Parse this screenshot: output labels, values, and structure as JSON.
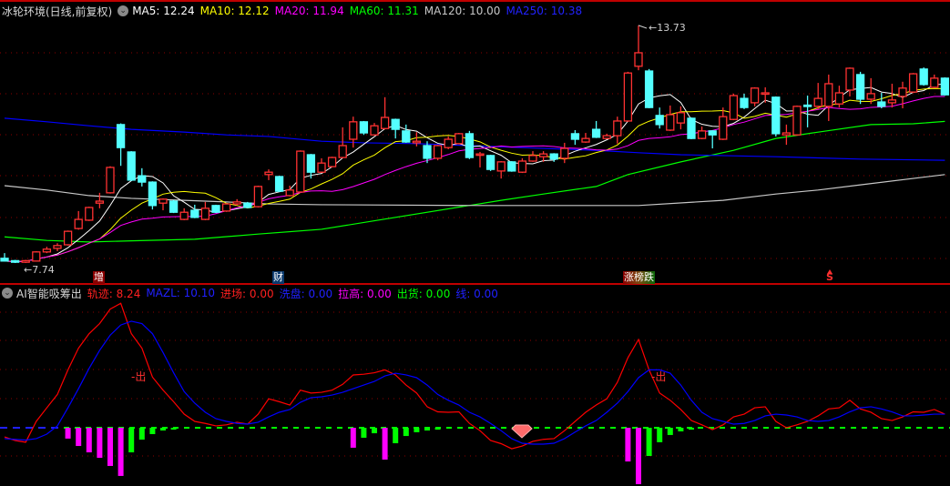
{
  "main_header": {
    "title": "冰轮环境(日线,前复权)",
    "ma_labels": [
      {
        "text": "MA5: 12.24",
        "color": "#ffffff"
      },
      {
        "text": "MA10: 12.12",
        "color": "#ffff00"
      },
      {
        "text": "MA20: 11.94",
        "color": "#ff00ff"
      },
      {
        "text": "MA60: 11.31",
        "color": "#00ff00"
      },
      {
        "text": "MA120: 10.00",
        "color": "#c8c8c8"
      },
      {
        "text": "MA250: 10.38",
        "color": "#0000ff"
      }
    ]
  },
  "indicator_header": {
    "title": "AI智能吸筹出",
    "items": [
      {
        "text": "轨迹: 8.24",
        "color": "#ff2020"
      },
      {
        "text": "MAZL: 10.10",
        "color": "#2020ff"
      },
      {
        "text": "进场: 0.00",
        "color": "#ff2020"
      },
      {
        "text": "洗盘: 0.00",
        "color": "#2020ff"
      },
      {
        "text": "拉高: 0.00",
        "color": "#ff00ff"
      },
      {
        "text": "出货: 0.00",
        "color": "#00ff00"
      },
      {
        "text": "线: 0.00",
        "color": "#2020ff"
      }
    ]
  },
  "annotations": {
    "high_label": "13.73",
    "low_label": "7.74",
    "event_tags": [
      {
        "text": "增",
        "bg": "#8b0000"
      },
      {
        "text": "财",
        "bg": "#0a3a6e"
      },
      {
        "text": "涨榜跌",
        "bg": "#7a2a10"
      }
    ],
    "signal_s": "S",
    "exit_labels": [
      "-出",
      "-出"
    ]
  },
  "colors": {
    "up": "#ff3232",
    "down": "#54ffff",
    "grid": "#8b0000"
  },
  "chart_data": [
    {
      "type": "candlestick",
      "title": "冰轮环境(日线,前复权)",
      "ylim": [
        7.74,
        13.73
      ],
      "ohlc": [
        [
          7.86,
          7.99,
          7.78,
          7.79
        ],
        [
          7.8,
          7.82,
          7.74,
          7.76
        ],
        [
          7.76,
          7.82,
          7.74,
          7.8
        ],
        [
          7.79,
          8.04,
          7.78,
          8.02
        ],
        [
          8.02,
          8.15,
          7.99,
          8.09
        ],
        [
          8.11,
          8.24,
          8.04,
          8.18
        ],
        [
          8.2,
          8.56,
          8.18,
          8.54
        ],
        [
          8.61,
          9.05,
          8.58,
          8.84
        ],
        [
          8.82,
          9.16,
          8.8,
          9.14
        ],
        [
          9.25,
          9.51,
          9.12,
          9.3
        ],
        [
          9.51,
          10.18,
          9.49,
          10.15
        ],
        [
          11.23,
          11.26,
          10.19,
          10.65
        ],
        [
          10.54,
          10.56,
          9.81,
          9.83
        ],
        [
          9.94,
          10.13,
          9.67,
          9.78
        ],
        [
          9.78,
          9.8,
          9.09,
          9.19
        ],
        [
          9.25,
          9.37,
          9.07,
          9.35
        ],
        [
          9.3,
          9.33,
          9.0,
          9.02
        ],
        [
          8.84,
          9.12,
          8.82,
          9.02
        ],
        [
          9.07,
          9.21,
          8.87,
          8.89
        ],
        [
          8.84,
          9.28,
          8.82,
          9.12
        ],
        [
          9.19,
          9.21,
          9.0,
          9.02
        ],
        [
          9.05,
          9.25,
          9.03,
          9.23
        ],
        [
          9.23,
          9.35,
          9.19,
          9.28
        ],
        [
          9.25,
          9.28,
          9.12,
          9.14
        ],
        [
          9.16,
          9.69,
          9.14,
          9.67
        ],
        [
          9.97,
          10.1,
          9.83,
          10.03
        ],
        [
          9.92,
          9.94,
          9.53,
          9.55
        ],
        [
          9.44,
          9.69,
          9.42,
          9.58
        ],
        [
          9.53,
          10.58,
          9.51,
          10.56
        ],
        [
          10.47,
          10.49,
          9.87,
          10.03
        ],
        [
          10.03,
          10.38,
          10.01,
          10.26
        ],
        [
          10.17,
          10.42,
          10.15,
          10.4
        ],
        [
          10.4,
          11.16,
          10.38,
          10.7
        ],
        [
          10.86,
          11.43,
          10.65,
          11.3
        ],
        [
          11.3,
          11.32,
          10.97,
          11.02
        ],
        [
          10.97,
          11.27,
          10.95,
          11.2
        ],
        [
          11.13,
          11.92,
          11.11,
          11.41
        ],
        [
          11.36,
          11.38,
          10.88,
          11.11
        ],
        [
          11.07,
          11.23,
          10.77,
          10.79
        ],
        [
          10.77,
          11.04,
          10.68,
          10.81
        ],
        [
          10.7,
          10.81,
          10.26,
          10.38
        ],
        [
          10.38,
          10.72,
          10.33,
          10.7
        ],
        [
          10.65,
          10.93,
          10.61,
          10.86
        ],
        [
          10.75,
          11.02,
          10.73,
          11.0
        ],
        [
          11.0,
          11.07,
          10.36,
          10.4
        ],
        [
          10.49,
          10.54,
          10.15,
          10.49
        ],
        [
          10.45,
          10.47,
          10.06,
          10.1
        ],
        [
          10.06,
          10.31,
          9.87,
          10.29
        ],
        [
          10.29,
          10.31,
          10.04,
          10.06
        ],
        [
          10.03,
          10.38,
          10.01,
          10.31
        ],
        [
          10.31,
          10.56,
          10.29,
          10.45
        ],
        [
          10.42,
          10.56,
          10.29,
          10.49
        ],
        [
          10.49,
          10.51,
          10.29,
          10.36
        ],
        [
          10.38,
          10.77,
          10.26,
          10.63
        ],
        [
          11.0,
          11.09,
          10.72,
          10.86
        ],
        [
          10.79,
          11.02,
          10.77,
          10.88
        ],
        [
          11.11,
          11.32,
          10.89,
          10.91
        ],
        [
          10.88,
          11.0,
          10.86,
          10.95
        ],
        [
          10.95,
          11.43,
          10.75,
          11.32
        ],
        [
          11.32,
          12.56,
          11.3,
          12.53
        ],
        [
          12.7,
          13.73,
          12.6,
          13.04
        ],
        [
          12.58,
          12.63,
          11.64,
          11.66
        ],
        [
          11.46,
          11.66,
          11.13,
          11.23
        ],
        [
          11.09,
          11.71,
          11.07,
          11.48
        ],
        [
          11.27,
          11.69,
          11.11,
          11.53
        ],
        [
          11.39,
          11.41,
          10.86,
          10.88
        ],
        [
          10.88,
          11.18,
          10.86,
          11.07
        ],
        [
          11.07,
          11.09,
          10.63,
          10.97
        ],
        [
          10.86,
          11.66,
          10.84,
          11.43
        ],
        [
          11.36,
          12.01,
          11.34,
          11.96
        ],
        [
          11.89,
          12.01,
          11.62,
          11.66
        ],
        [
          11.78,
          12.17,
          11.69,
          12.15
        ],
        [
          12.03,
          12.17,
          11.78,
          12.03
        ],
        [
          11.92,
          11.94,
          10.93,
          11.0
        ],
        [
          10.97,
          11.23,
          10.72,
          11.02
        ],
        [
          10.97,
          11.71,
          10.95,
          11.69
        ],
        [
          11.72,
          11.96,
          11.16,
          11.71
        ],
        [
          11.69,
          12.28,
          11.62,
          11.89
        ],
        [
          11.69,
          12.49,
          11.32,
          12.26
        ],
        [
          11.75,
          12.21,
          11.66,
          12.03
        ],
        [
          12.1,
          12.67,
          11.94,
          12.65
        ],
        [
          12.49,
          12.56,
          11.75,
          11.87
        ],
        [
          11.87,
          12.4,
          11.75,
          12.01
        ],
        [
          11.8,
          12.03,
          11.64,
          11.69
        ],
        [
          11.78,
          12.26,
          11.66,
          11.85
        ],
        [
          11.94,
          12.31,
          11.64,
          12.15
        ],
        [
          12.05,
          12.53,
          12.03,
          12.51
        ],
        [
          12.63,
          12.67,
          12.21,
          12.24
        ],
        [
          12.17,
          12.49,
          12.15,
          12.4
        ],
        [
          12.4,
          12.42,
          11.96,
          11.98
        ]
      ],
      "computed_ma": [
        {
          "name": "MA5",
          "period": 5,
          "color": "#ffffff"
        },
        {
          "name": "MA10",
          "period": 10,
          "color": "#ffff00"
        },
        {
          "name": "MA20",
          "period": 20,
          "color": "#ff00ff"
        }
      ],
      "sampled_ma": [
        {
          "name": "MA60",
          "color": "#00ff00",
          "points": [
            [
              0,
              8.4
            ],
            [
              4,
              8.31
            ],
            [
              8,
              8.27
            ],
            [
              12,
              8.3
            ],
            [
              18,
              8.34
            ],
            [
              24,
              8.47
            ],
            [
              30,
              8.59
            ],
            [
              47,
              9.32
            ],
            [
              51,
              9.48
            ],
            [
              56,
              9.67
            ],
            [
              59,
              9.97
            ],
            [
              64,
              10.29
            ],
            [
              69,
              10.58
            ],
            [
              73,
              10.88
            ],
            [
              77,
              11.04
            ],
            [
              82,
              11.23
            ],
            [
              86,
              11.25
            ],
            [
              89,
              11.31
            ]
          ]
        },
        {
          "name": "MA120",
          "color": "#c8c8c8",
          "points": [
            [
              0,
              9.69
            ],
            [
              4,
              9.58
            ],
            [
              8,
              9.44
            ],
            [
              12,
              9.37
            ],
            [
              17,
              9.32
            ],
            [
              21,
              9.28
            ],
            [
              25,
              9.23
            ],
            [
              30,
              9.21
            ],
            [
              45,
              9.19
            ],
            [
              60,
              9.19
            ],
            [
              68,
              9.32
            ],
            [
              73,
              9.48
            ],
            [
              77,
              9.58
            ],
            [
              81,
              9.71
            ],
            [
              89,
              9.97
            ]
          ]
        },
        {
          "name": "MA250",
          "color": "#0000ff",
          "points": [
            [
              0,
              11.39
            ],
            [
              4,
              11.3
            ],
            [
              8,
              11.2
            ],
            [
              12,
              11.11
            ],
            [
              17,
              11.04
            ],
            [
              21,
              10.97
            ],
            [
              25,
              10.93
            ],
            [
              30,
              10.81
            ],
            [
              34,
              10.77
            ],
            [
              39,
              10.75
            ],
            [
              44,
              10.7
            ],
            [
              51,
              10.63
            ],
            [
              56,
              10.58
            ],
            [
              60,
              10.52
            ],
            [
              64,
              10.47
            ],
            [
              73,
              10.42
            ],
            [
              81,
              10.36
            ],
            [
              89,
              10.33
            ]
          ]
        }
      ]
    },
    {
      "type": "line",
      "title": "AI智能吸筹出",
      "ylim": [
        -40,
        90
      ],
      "series": [
        {
          "name": "轨迹",
          "color": "#ff0000",
          "values": [
            -6.3,
            -8.8,
            -10,
            4.4,
            13.8,
            23,
            40,
            55,
            65,
            72,
            82,
            86,
            65,
            55,
            35,
            26,
            18,
            9.4,
            4.4,
            3,
            1.3,
            2,
            3.8,
            2.5,
            9.4,
            20,
            18,
            15.7,
            26,
            24,
            24.5,
            26,
            30,
            36.5,
            37,
            38,
            40,
            36.5,
            29.5,
            24,
            14.5,
            11,
            10.7,
            11,
            3,
            -2,
            -8.8,
            -11,
            -14.5,
            -12.6,
            -9.4,
            -8,
            -7.5,
            -2,
            4.4,
            10.7,
            15.7,
            20,
            31.4,
            48.4,
            61,
            40,
            24,
            19,
            12.6,
            5,
            2,
            -1.3,
            2,
            7.5,
            9.4,
            13.8,
            14.5,
            4.4,
            0,
            2,
            4.4,
            8.2,
            13,
            13.8,
            19,
            13,
            10.7,
            6.3,
            5,
            7.5,
            11,
            10.7,
            12.6,
            9.4
          ]
        },
        {
          "name": "MAZL",
          "color": "#0000ff",
          "values": [
            -7.5,
            -8,
            -8.5,
            -7.5,
            -4.4,
            1.3,
            13.8,
            27,
            41,
            53.5,
            64,
            71,
            73.6,
            72,
            65,
            52,
            38,
            25,
            17,
            10.7,
            6.3,
            4.4,
            3,
            2.5,
            3.8,
            7.5,
            10.7,
            12.6,
            17.6,
            20.8,
            21.4,
            22.6,
            24.5,
            27,
            29.5,
            32,
            35.8,
            37.7,
            36.5,
            34.6,
            29.5,
            23,
            19,
            15.7,
            10.7,
            7.5,
            3,
            -2,
            -7.5,
            -10.7,
            -11.3,
            -11.3,
            -10.7,
            -7.5,
            -3,
            1.3,
            5,
            10.7,
            17,
            25,
            34.6,
            40,
            40,
            37.7,
            29.5,
            19,
            10.7,
            6.3,
            4.4,
            2.5,
            3,
            5,
            8.2,
            9.4,
            8.8,
            7.5,
            5,
            4.4,
            5,
            7.5,
            11,
            13.8,
            14.5,
            13,
            11,
            8.2,
            8.2,
            8.8,
            9.4,
            9.4
          ]
        }
      ],
      "histogram": [
        {
          "i": 6,
          "v": -7.5,
          "color": "#ff00ff"
        },
        {
          "i": 7,
          "v": -12.6,
          "color": "#ff00ff"
        },
        {
          "i": 8,
          "v": -17,
          "color": "#ff00ff"
        },
        {
          "i": 9,
          "v": -20.8,
          "color": "#ff00ff"
        },
        {
          "i": 10,
          "v": -26.4,
          "color": "#ff00ff"
        },
        {
          "i": 11,
          "v": -33.3,
          "color": "#ff00ff"
        },
        {
          "i": 12,
          "v": -17,
          "color": "#00ff00"
        },
        {
          "i": 13,
          "v": -8.2,
          "color": "#00ff00"
        },
        {
          "i": 14,
          "v": -4.4,
          "color": "#00ff00"
        },
        {
          "i": 15,
          "v": -1.9,
          "color": "#00ff00"
        },
        {
          "i": 16,
          "v": -1.3,
          "color": "#00ff00"
        },
        {
          "i": 33,
          "v": -13.8,
          "color": "#ff00ff"
        },
        {
          "i": 34,
          "v": -6.9,
          "color": "#00ff00"
        },
        {
          "i": 35,
          "v": -3.8,
          "color": "#00ff00"
        },
        {
          "i": 36,
          "v": -22,
          "color": "#ff00ff"
        },
        {
          "i": 37,
          "v": -10.7,
          "color": "#00ff00"
        },
        {
          "i": 38,
          "v": -5.7,
          "color": "#00ff00"
        },
        {
          "i": 39,
          "v": -3.1,
          "color": "#00ff00"
        },
        {
          "i": 40,
          "v": -1.9,
          "color": "#00ff00"
        },
        {
          "i": 41,
          "v": -1.3,
          "color": "#00ff00"
        },
        {
          "i": 59,
          "v": -23.3,
          "color": "#ff00ff"
        },
        {
          "i": 60,
          "v": -39,
          "color": "#ff00ff"
        },
        {
          "i": 61,
          "v": -19.5,
          "color": "#00ff00"
        },
        {
          "i": 62,
          "v": -10,
          "color": "#00ff00"
        },
        {
          "i": 63,
          "v": -5,
          "color": "#00ff00"
        },
        {
          "i": 64,
          "v": -2.5,
          "color": "#00ff00"
        },
        {
          "i": 65,
          "v": -1.3,
          "color": "#00ff00"
        }
      ],
      "zero_line": 0
    }
  ]
}
